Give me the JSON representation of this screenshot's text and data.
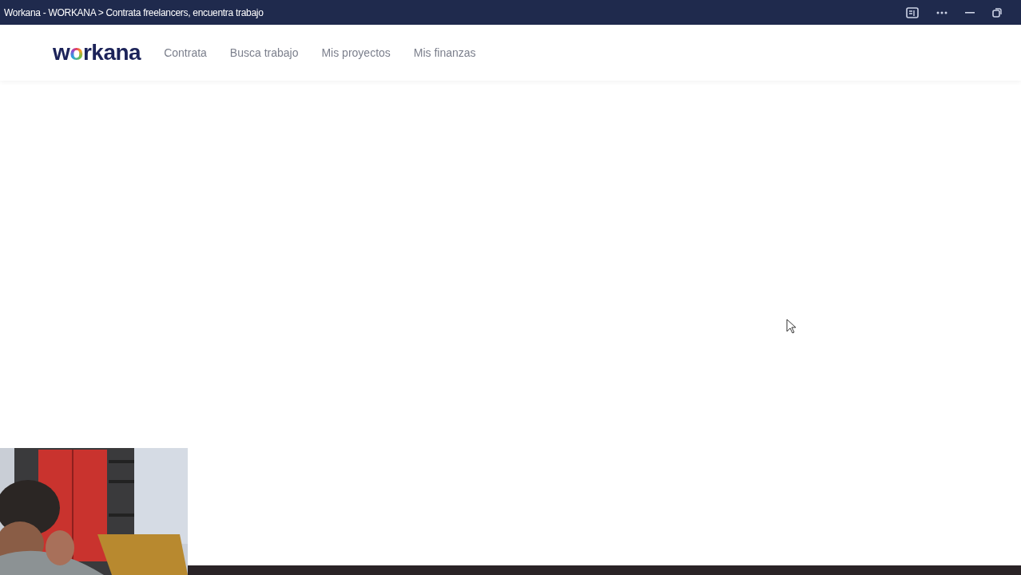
{
  "window": {
    "title": "Workana - WORKANA > Contrata freelancers, encuentra trabajo"
  },
  "header": {
    "logo": "workana",
    "nav": [
      {
        "label": "Contrata"
      },
      {
        "label": "Busca trabajo"
      },
      {
        "label": "Mis proyectos"
      },
      {
        "label": "Mis finanzas"
      }
    ]
  }
}
